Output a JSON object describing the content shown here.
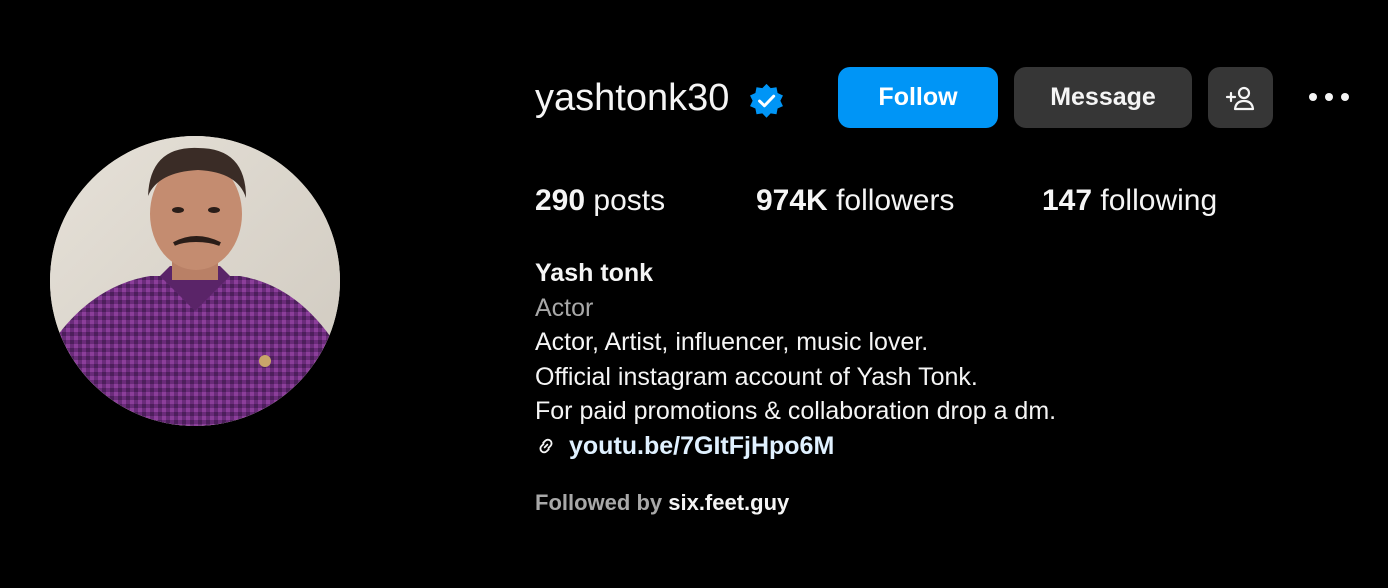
{
  "profile": {
    "username": "yashtonk30",
    "verified": true,
    "verified_icon": "verified-badge-icon",
    "avatar_alt": "avatar"
  },
  "actions": {
    "follow_label": "Follow",
    "message_label": "Message",
    "add_user_icon": "person-plus-icon",
    "more_icon": "ellipsis-icon"
  },
  "stats": {
    "posts_count": "290",
    "posts_label": "posts",
    "followers_count": "974K",
    "followers_label": "followers",
    "following_count": "147",
    "following_label": "following"
  },
  "bio": {
    "name": "Yash tonk",
    "category": "Actor",
    "lines": [
      "Actor, Artist, influencer, music lover.",
      "Official instagram account of Yash Tonk.",
      "For paid promotions & collaboration drop a dm."
    ],
    "link_icon": "link-icon",
    "link_text": "youtu.be/7GItFjHpo6M"
  },
  "followed_by": {
    "prefix": "Followed by ",
    "user": "six.feet.guy"
  },
  "colors": {
    "background": "#000000",
    "primary_button": "#0095f6",
    "secondary_button": "#363636",
    "verified": "#0095f6",
    "muted_text": "#a8a8a8",
    "link_text": "#e0f1ff"
  }
}
